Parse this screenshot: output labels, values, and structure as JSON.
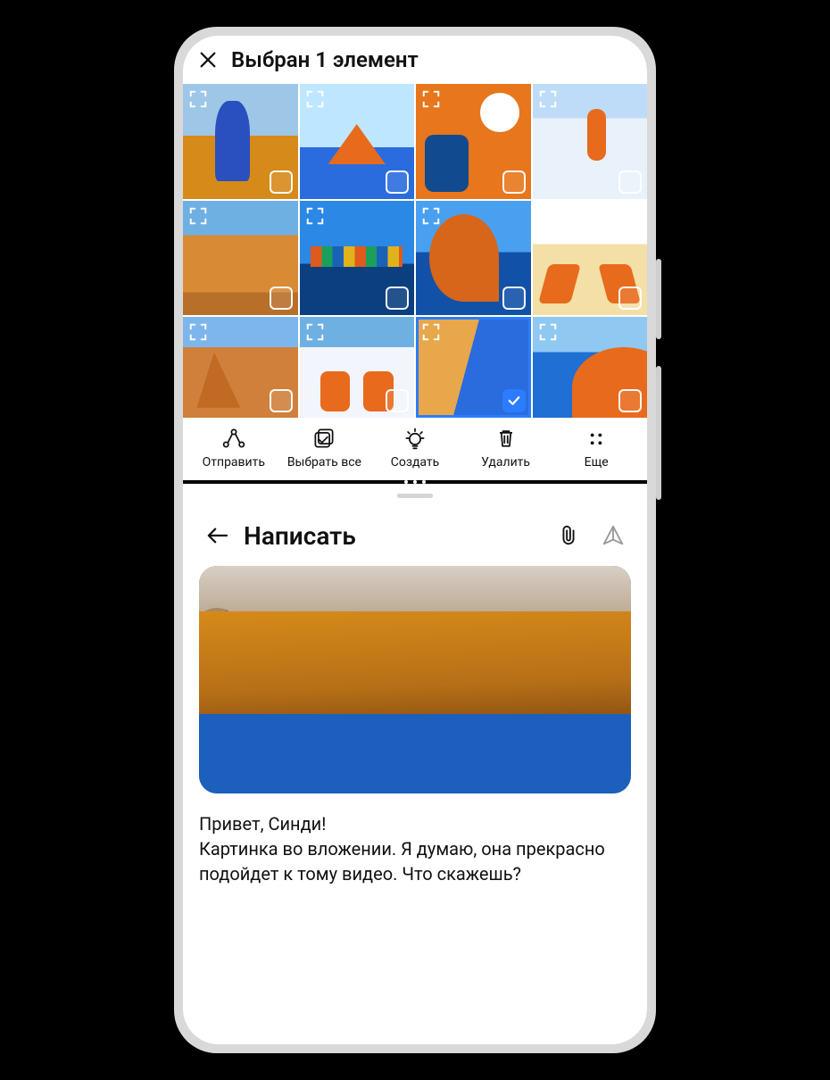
{
  "gallery": {
    "title": "Выбран 1 элемент",
    "thumbnails": [
      {
        "name": "photo-tulip-field",
        "selected": false,
        "art": "t1"
      },
      {
        "name": "photo-paper-boat",
        "selected": false,
        "art": "t2"
      },
      {
        "name": "photo-beach-objects",
        "selected": false,
        "art": "t3"
      },
      {
        "name": "photo-skier",
        "selected": false,
        "art": "t4"
      },
      {
        "name": "photo-desert-camels",
        "selected": false,
        "art": "t5"
      },
      {
        "name": "photo-color-houses",
        "selected": false,
        "art": "t6"
      },
      {
        "name": "photo-rock-arch",
        "selected": false,
        "art": "t7"
      },
      {
        "name": "photo-beach-chairs",
        "selected": false,
        "art": "t8"
      },
      {
        "name": "photo-desert-rocks",
        "selected": false,
        "art": "t9"
      },
      {
        "name": "photo-snow-chairs",
        "selected": false,
        "art": "t10"
      },
      {
        "name": "photo-shoreline",
        "selected": true,
        "art": "t11"
      },
      {
        "name": "photo-umbrella",
        "selected": false,
        "art": "t12"
      }
    ],
    "toolbar": {
      "send_label": "Отправить",
      "select_all_label": "Выбрать все",
      "create_label": "Создать",
      "delete_label": "Удалить",
      "more_label": "Еще"
    }
  },
  "compose": {
    "title": "Написать",
    "message_line1": "Привет, Синди!",
    "message_line2": "Картинка во вложении. Я думаю, она прекрасно подойдет к тому видео. Что скажешь?"
  }
}
